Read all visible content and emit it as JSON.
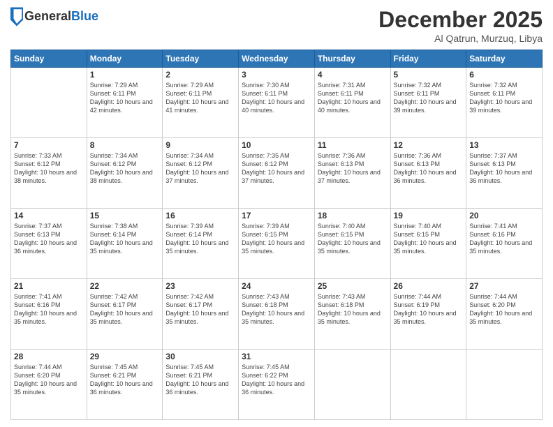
{
  "logo": {
    "general": "General",
    "blue": "Blue"
  },
  "header": {
    "title": "December 2025",
    "location": "Al Qatrun, Murzuq, Libya"
  },
  "weekdays": [
    "Sunday",
    "Monday",
    "Tuesday",
    "Wednesday",
    "Thursday",
    "Friday",
    "Saturday"
  ],
  "days": [
    {
      "num": "",
      "sunrise": "",
      "sunset": "",
      "daylight": ""
    },
    {
      "num": "1",
      "sunrise": "Sunrise: 7:29 AM",
      "sunset": "Sunset: 6:11 PM",
      "daylight": "Daylight: 10 hours and 42 minutes."
    },
    {
      "num": "2",
      "sunrise": "Sunrise: 7:29 AM",
      "sunset": "Sunset: 6:11 PM",
      "daylight": "Daylight: 10 hours and 41 minutes."
    },
    {
      "num": "3",
      "sunrise": "Sunrise: 7:30 AM",
      "sunset": "Sunset: 6:11 PM",
      "daylight": "Daylight: 10 hours and 40 minutes."
    },
    {
      "num": "4",
      "sunrise": "Sunrise: 7:31 AM",
      "sunset": "Sunset: 6:11 PM",
      "daylight": "Daylight: 10 hours and 40 minutes."
    },
    {
      "num": "5",
      "sunrise": "Sunrise: 7:32 AM",
      "sunset": "Sunset: 6:11 PM",
      "daylight": "Daylight: 10 hours and 39 minutes."
    },
    {
      "num": "6",
      "sunrise": "Sunrise: 7:32 AM",
      "sunset": "Sunset: 6:11 PM",
      "daylight": "Daylight: 10 hours and 39 minutes."
    },
    {
      "num": "7",
      "sunrise": "Sunrise: 7:33 AM",
      "sunset": "Sunset: 6:12 PM",
      "daylight": "Daylight: 10 hours and 38 minutes."
    },
    {
      "num": "8",
      "sunrise": "Sunrise: 7:34 AM",
      "sunset": "Sunset: 6:12 PM",
      "daylight": "Daylight: 10 hours and 38 minutes."
    },
    {
      "num": "9",
      "sunrise": "Sunrise: 7:34 AM",
      "sunset": "Sunset: 6:12 PM",
      "daylight": "Daylight: 10 hours and 37 minutes."
    },
    {
      "num": "10",
      "sunrise": "Sunrise: 7:35 AM",
      "sunset": "Sunset: 6:12 PM",
      "daylight": "Daylight: 10 hours and 37 minutes."
    },
    {
      "num": "11",
      "sunrise": "Sunrise: 7:36 AM",
      "sunset": "Sunset: 6:13 PM",
      "daylight": "Daylight: 10 hours and 37 minutes."
    },
    {
      "num": "12",
      "sunrise": "Sunrise: 7:36 AM",
      "sunset": "Sunset: 6:13 PM",
      "daylight": "Daylight: 10 hours and 36 minutes."
    },
    {
      "num": "13",
      "sunrise": "Sunrise: 7:37 AM",
      "sunset": "Sunset: 6:13 PM",
      "daylight": "Daylight: 10 hours and 36 minutes."
    },
    {
      "num": "14",
      "sunrise": "Sunrise: 7:37 AM",
      "sunset": "Sunset: 6:13 PM",
      "daylight": "Daylight: 10 hours and 36 minutes."
    },
    {
      "num": "15",
      "sunrise": "Sunrise: 7:38 AM",
      "sunset": "Sunset: 6:14 PM",
      "daylight": "Daylight: 10 hours and 35 minutes."
    },
    {
      "num": "16",
      "sunrise": "Sunrise: 7:39 AM",
      "sunset": "Sunset: 6:14 PM",
      "daylight": "Daylight: 10 hours and 35 minutes."
    },
    {
      "num": "17",
      "sunrise": "Sunrise: 7:39 AM",
      "sunset": "Sunset: 6:15 PM",
      "daylight": "Daylight: 10 hours and 35 minutes."
    },
    {
      "num": "18",
      "sunrise": "Sunrise: 7:40 AM",
      "sunset": "Sunset: 6:15 PM",
      "daylight": "Daylight: 10 hours and 35 minutes."
    },
    {
      "num": "19",
      "sunrise": "Sunrise: 7:40 AM",
      "sunset": "Sunset: 6:15 PM",
      "daylight": "Daylight: 10 hours and 35 minutes."
    },
    {
      "num": "20",
      "sunrise": "Sunrise: 7:41 AM",
      "sunset": "Sunset: 6:16 PM",
      "daylight": "Daylight: 10 hours and 35 minutes."
    },
    {
      "num": "21",
      "sunrise": "Sunrise: 7:41 AM",
      "sunset": "Sunset: 6:16 PM",
      "daylight": "Daylight: 10 hours and 35 minutes."
    },
    {
      "num": "22",
      "sunrise": "Sunrise: 7:42 AM",
      "sunset": "Sunset: 6:17 PM",
      "daylight": "Daylight: 10 hours and 35 minutes."
    },
    {
      "num": "23",
      "sunrise": "Sunrise: 7:42 AM",
      "sunset": "Sunset: 6:17 PM",
      "daylight": "Daylight: 10 hours and 35 minutes."
    },
    {
      "num": "24",
      "sunrise": "Sunrise: 7:43 AM",
      "sunset": "Sunset: 6:18 PM",
      "daylight": "Daylight: 10 hours and 35 minutes."
    },
    {
      "num": "25",
      "sunrise": "Sunrise: 7:43 AM",
      "sunset": "Sunset: 6:18 PM",
      "daylight": "Daylight: 10 hours and 35 minutes."
    },
    {
      "num": "26",
      "sunrise": "Sunrise: 7:44 AM",
      "sunset": "Sunset: 6:19 PM",
      "daylight": "Daylight: 10 hours and 35 minutes."
    },
    {
      "num": "27",
      "sunrise": "Sunrise: 7:44 AM",
      "sunset": "Sunset: 6:20 PM",
      "daylight": "Daylight: 10 hours and 35 minutes."
    },
    {
      "num": "28",
      "sunrise": "Sunrise: 7:44 AM",
      "sunset": "Sunset: 6:20 PM",
      "daylight": "Daylight: 10 hours and 35 minutes."
    },
    {
      "num": "29",
      "sunrise": "Sunrise: 7:45 AM",
      "sunset": "Sunset: 6:21 PM",
      "daylight": "Daylight: 10 hours and 36 minutes."
    },
    {
      "num": "30",
      "sunrise": "Sunrise: 7:45 AM",
      "sunset": "Sunset: 6:21 PM",
      "daylight": "Daylight: 10 hours and 36 minutes."
    },
    {
      "num": "31",
      "sunrise": "Sunrise: 7:45 AM",
      "sunset": "Sunset: 6:22 PM",
      "daylight": "Daylight: 10 hours and 36 minutes."
    }
  ]
}
